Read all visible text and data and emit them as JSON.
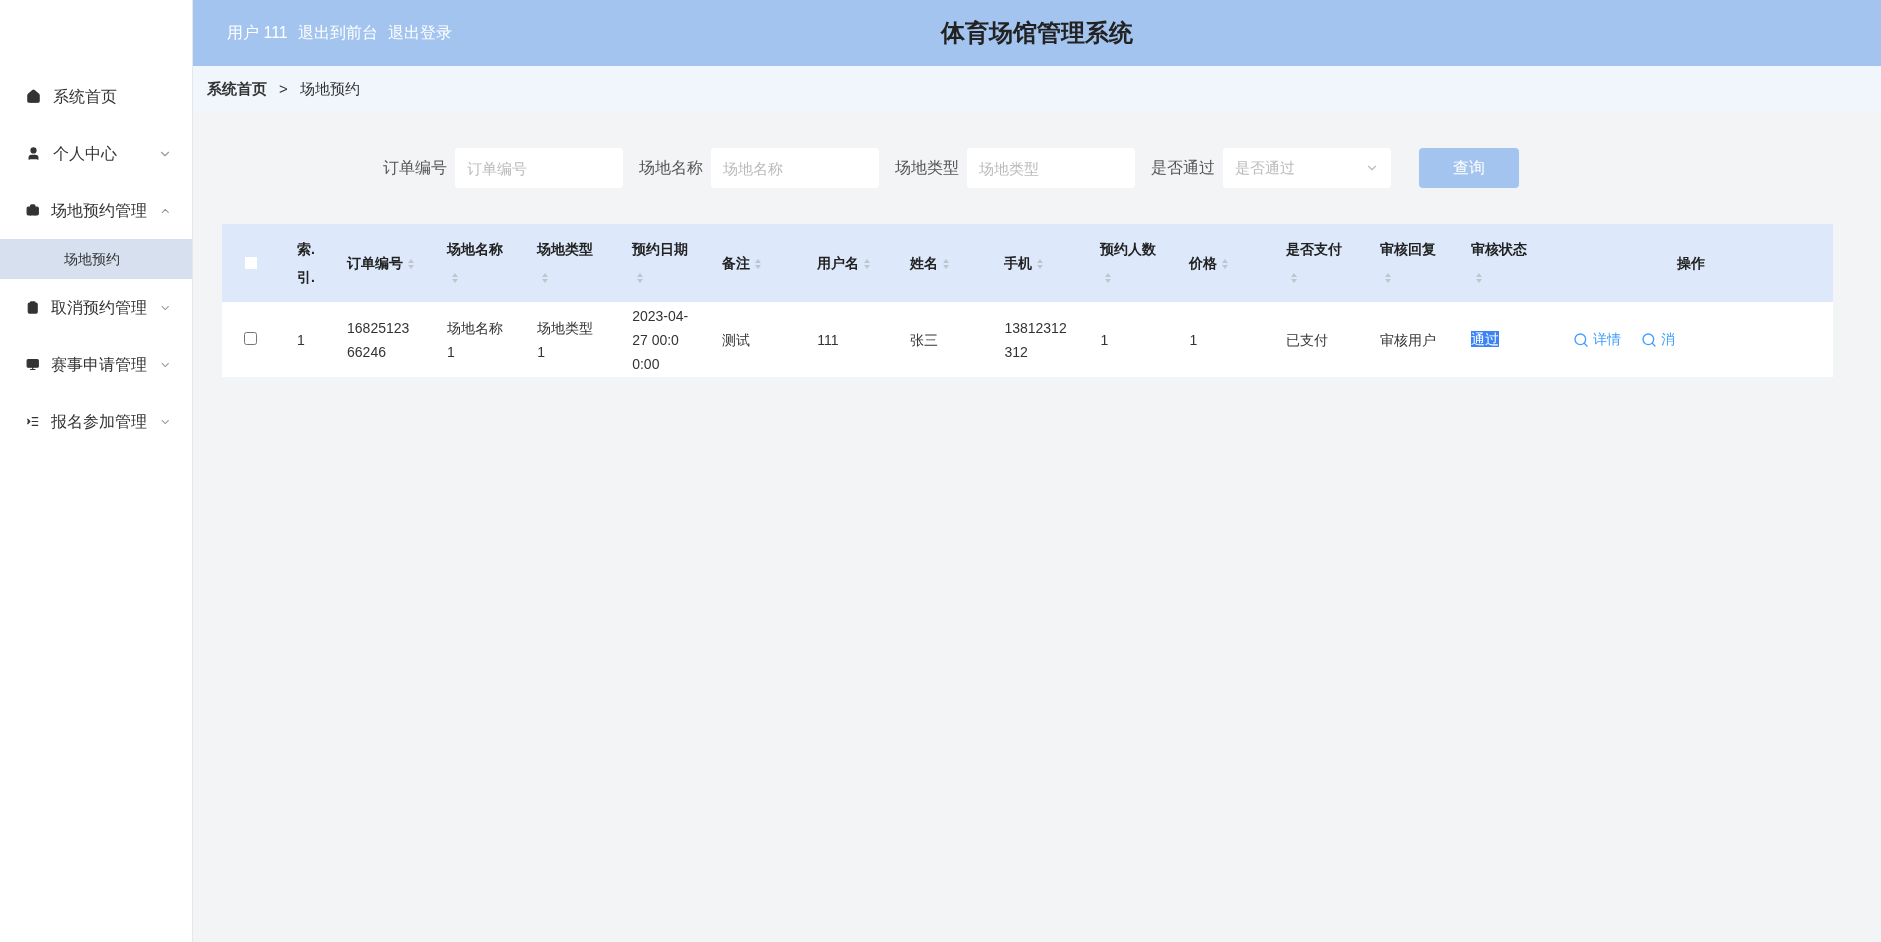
{
  "header": {
    "user": "用户 111",
    "links": [
      "退出到前台",
      "退出登录"
    ],
    "title": "体育场馆管理系统"
  },
  "sidebar": {
    "items": [
      {
        "label": "系统首页"
      },
      {
        "label": "个人中心",
        "expanded": false
      },
      {
        "label": "场地预约管理",
        "expanded": true,
        "children": [
          {
            "label": "场地预约",
            "selected": true
          }
        ]
      },
      {
        "label": "取消预约管理",
        "expanded": false
      },
      {
        "label": "赛事申请管理",
        "expanded": false
      },
      {
        "label": "报名参加管理",
        "expanded": false
      }
    ]
  },
  "breadcrumb": {
    "items": [
      "系统首页",
      "场地预约"
    ],
    "separator": ">"
  },
  "search": {
    "fields": [
      {
        "kind": "input",
        "label": "订单编号",
        "placeholder": "订单编号"
      },
      {
        "kind": "input",
        "label": "场地名称",
        "placeholder": "场地名称"
      },
      {
        "kind": "input",
        "label": "场地类型",
        "placeholder": "场地类型"
      },
      {
        "kind": "select",
        "label": "是否通过",
        "placeholder": "是否通过"
      }
    ],
    "button": "查询"
  },
  "table": {
    "select_all": {
      "checked": false
    },
    "columns": [
      {
        "label": "索.引.",
        "sortable": false
      },
      {
        "label": "订单编号",
        "sortable": true
      },
      {
        "label": "场地名称",
        "sortable": true
      },
      {
        "label": "场地类型",
        "sortable": true
      },
      {
        "label": "预约日期",
        "sortable": true
      },
      {
        "label": "备注",
        "sortable": true
      },
      {
        "label": "用户名",
        "sortable": true
      },
      {
        "label": "姓名",
        "sortable": true
      },
      {
        "label": "手机",
        "sortable": true
      },
      {
        "label": "预约人数",
        "sortable": true
      },
      {
        "label": "价格",
        "sortable": true
      },
      {
        "label": "是否支付",
        "sortable": true
      },
      {
        "label": "审核回复",
        "sortable": true
      },
      {
        "label": "审核状态",
        "sortable": true
      },
      {
        "label": "操作",
        "sortable": false
      }
    ],
    "rows": [
      {
        "checked": false,
        "cells": [
          "1",
          "1682512366246",
          "场地名称1",
          "场地类型1",
          "2023-04-27 00:00:00",
          "测试",
          "111",
          "张三",
          "13812312312",
          "1",
          "1",
          "已支付",
          "审核用户"
        ],
        "status": {
          "text": "通过",
          "highlighted": true
        },
        "actions": [
          "详情",
          "消"
        ]
      }
    ]
  }
}
